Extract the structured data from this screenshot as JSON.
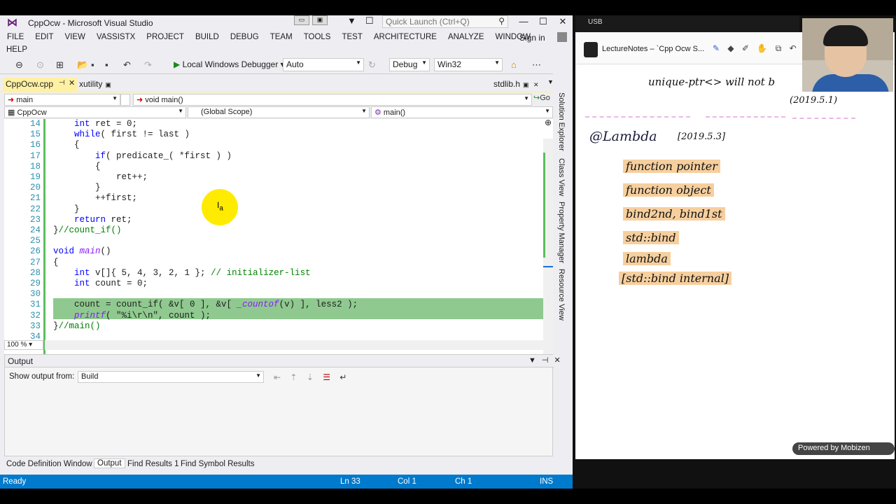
{
  "vs": {
    "title": "CppOcw - Microsoft Visual Studio",
    "quick_launch_placeholder": "Quick Launch (Ctrl+Q)",
    "menu": [
      "FILE",
      "EDIT",
      "VIEW",
      "VASSISTX",
      "PROJECT",
      "BUILD",
      "DEBUG",
      "TEAM",
      "TOOLS",
      "TEST",
      "ARCHITECTURE",
      "ANALYZE",
      "WINDOW"
    ],
    "menu_help": "HELP",
    "sign_in": "Sign in",
    "toolbar": {
      "debugger": "Local Windows Debugger",
      "config_auto": "Auto",
      "config_debug": "Debug",
      "platform": "Win32"
    },
    "tabs": {
      "active": "CppOcw.cpp",
      "second": "xutility",
      "right": "stdlib.h"
    },
    "nav": {
      "left": "main",
      "func": "void main()",
      "go": "Go",
      "project": "CppOcw",
      "scope": "(Global Scope)",
      "member": "main()"
    },
    "code_lines": [
      {
        "n": "14",
        "t": "    int ret = 0;"
      },
      {
        "n": "15",
        "t": "    while( first != last )"
      },
      {
        "n": "16",
        "t": "    {"
      },
      {
        "n": "17",
        "t": "        if( predicate_( *first ) )"
      },
      {
        "n": "18",
        "t": "        {"
      },
      {
        "n": "19",
        "t": "            ret++;"
      },
      {
        "n": "20",
        "t": "        }"
      },
      {
        "n": "21",
        "t": "        ++first;"
      },
      {
        "n": "22",
        "t": "    }"
      },
      {
        "n": "23",
        "t": "    return ret;"
      },
      {
        "n": "24",
        "t": "}//count_if()"
      },
      {
        "n": "25",
        "t": ""
      },
      {
        "n": "26",
        "t": "void main()"
      },
      {
        "n": "27",
        "t": "{"
      },
      {
        "n": "28",
        "t": "    int v[]{ 5, 4, 3, 2, 1 }; // initializer-list"
      },
      {
        "n": "29",
        "t": "    int count = 0;"
      },
      {
        "n": "30",
        "t": ""
      },
      {
        "n": "31",
        "t": "    count = count_if( &v[ 0 ], &v[ _countof(v) ], less2 );"
      },
      {
        "n": "32",
        "t": "    printf( \"%i\\r\\n\", count );"
      },
      {
        "n": "33",
        "t": "}//main()"
      },
      {
        "n": "34",
        "t": ""
      }
    ],
    "zoom": "100 %",
    "output": {
      "title": "Output",
      "show_from_label": "Show output from:",
      "source": "Build"
    },
    "bottom_tabs": [
      "Code Definition Window",
      "Output",
      "Find Results 1",
      "Find Symbol Results"
    ],
    "side_tabs": [
      "Solution Explorer",
      "Class View",
      "Property Manager",
      "Resource View"
    ],
    "status": {
      "ready": "Ready",
      "ln": "Ln 33",
      "col": "Col 1",
      "ch": "Ch 1",
      "ins": "INS"
    }
  },
  "notes": {
    "usb_label": "USB",
    "app_title": "LectureNotes – `Cpp Ocw S...",
    "line_top": "unique-ptr<>   will not b",
    "date1": "(2019.5.1)",
    "heading": "@Lambda",
    "date2": "[2019.5.3]",
    "items": [
      "function pointer",
      "function object",
      "bind2nd, bind1st",
      "std::bind",
      "lambda",
      "[std::bind internal]"
    ],
    "powered_by": "Powered by Mobizen"
  },
  "colors": {
    "status_blue": "#007acc",
    "tab_yellow": "#fff1a3",
    "selection_green": "#8fc98f",
    "highlight_orange": "#f6cf9e"
  }
}
